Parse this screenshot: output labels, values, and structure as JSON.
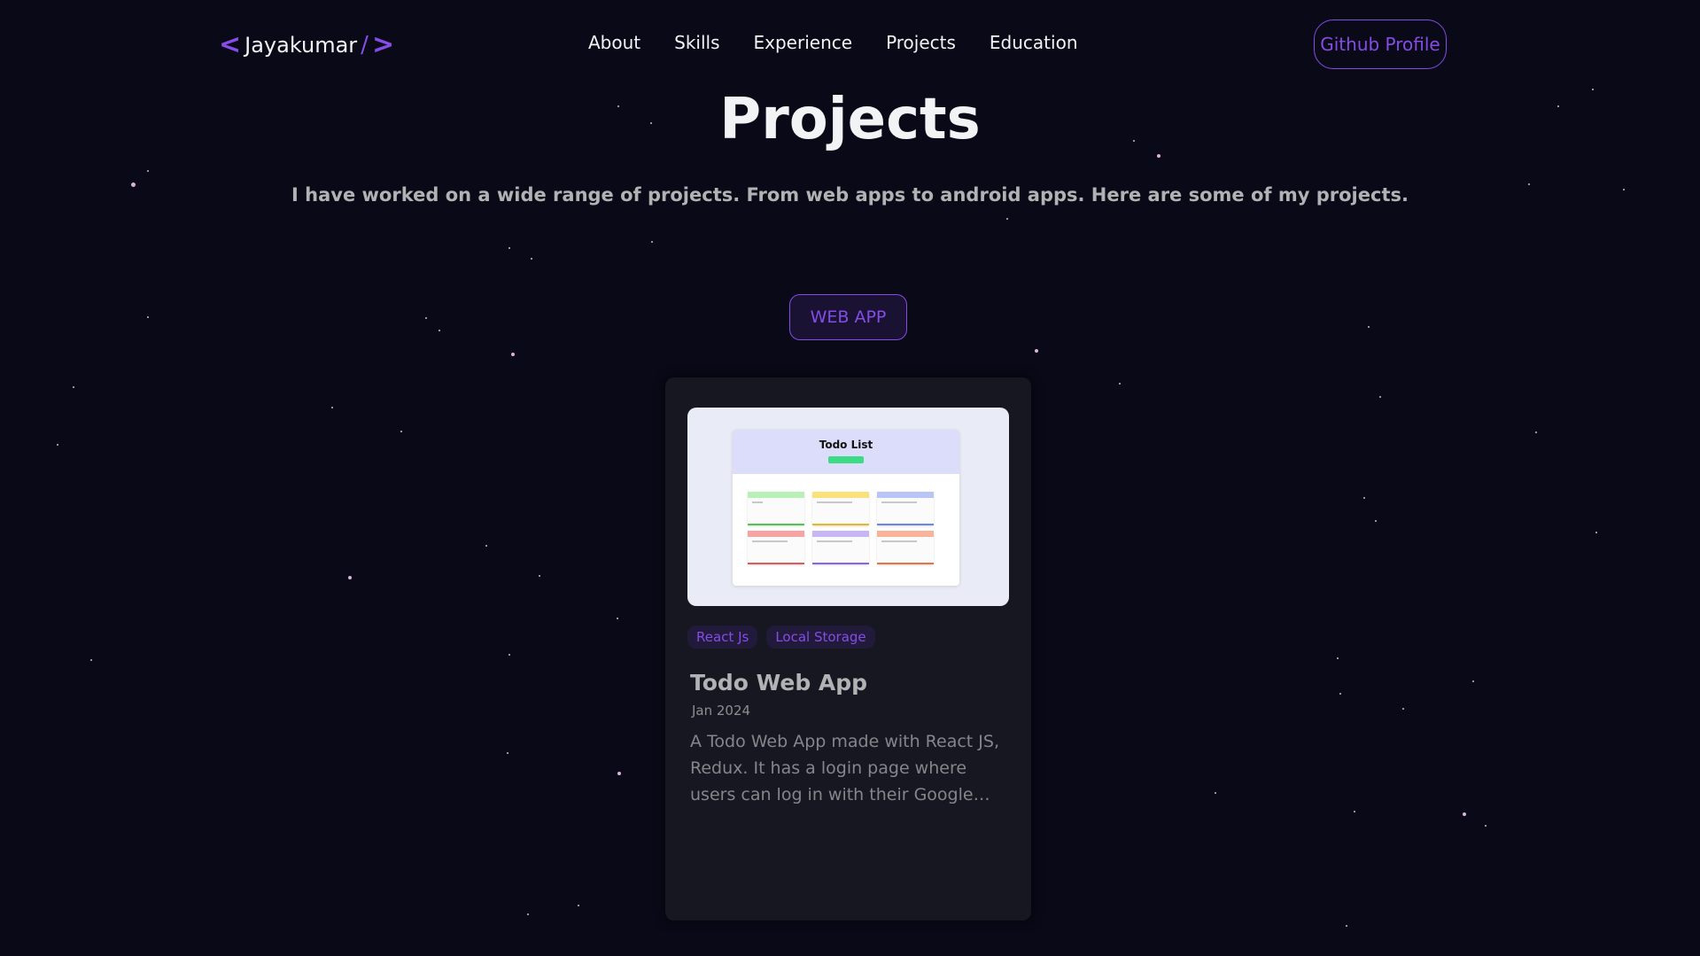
{
  "nav": {
    "logo": {
      "left": "<",
      "name": "Jayakumar",
      "slash": "/",
      "right": ">"
    },
    "links": [
      "About",
      "Skills",
      "Experience",
      "Projects",
      "Education"
    ],
    "github_label": "Github Profile"
  },
  "section": {
    "title": "Projects",
    "subtitle": "I have worked on a wide range of projects. From web apps to android apps. Here are some of my projects."
  },
  "filter": {
    "label": "WEB APP"
  },
  "project": {
    "tags": [
      "React Js",
      "Local Storage"
    ],
    "title": "Todo Web App",
    "date": "Jan 2024",
    "description": "A Todo Web App made with React JS, Redux. It has a login page where users can log in with their Google…",
    "thumbnail": {
      "heading": "Todo List"
    }
  },
  "colors": {
    "background": "#090917",
    "accent": "#854ce6",
    "card": "#171721",
    "text_primary": "#f2f3f4",
    "text_secondary": "#b1b2b3"
  }
}
